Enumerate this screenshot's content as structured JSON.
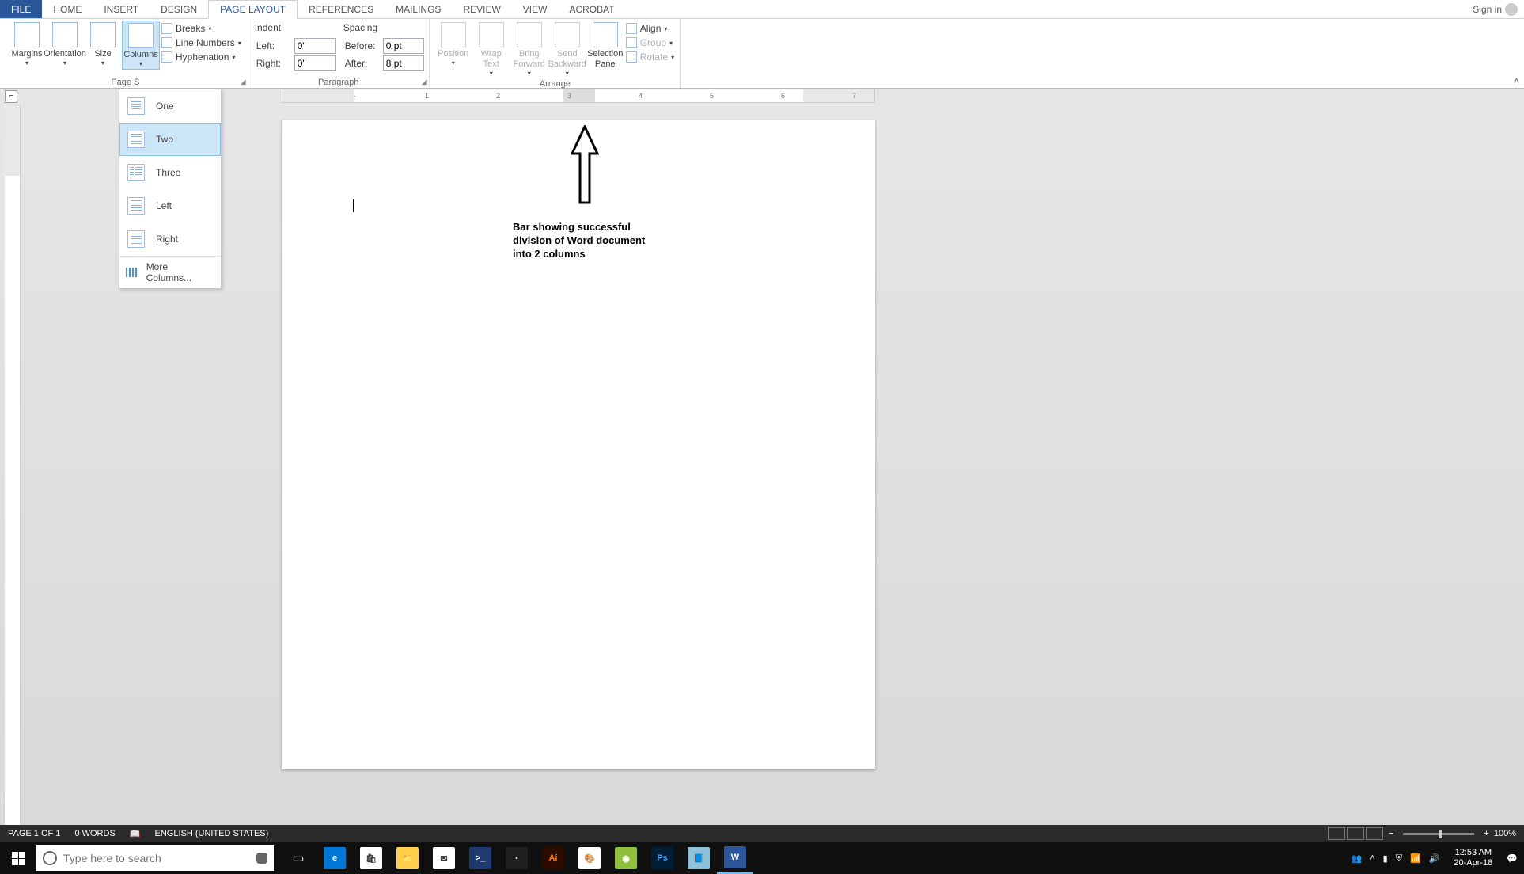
{
  "tabs": {
    "file": "FILE",
    "home": "HOME",
    "insert": "INSERT",
    "design": "DESIGN",
    "pagelayout": "PAGE LAYOUT",
    "references": "REFERENCES",
    "mailings": "MAILINGS",
    "review": "REVIEW",
    "view": "VIEW",
    "acrobat": "ACROBAT"
  },
  "signin": "Sign in",
  "ribbon": {
    "page_setup": {
      "label": "Page Setup",
      "label_truncated": "Page S",
      "margins": "Margins",
      "orientation": "Orientation",
      "size": "Size",
      "columns": "Columns",
      "breaks": "Breaks",
      "line_numbers": "Line Numbers",
      "hyphenation": "Hyphenation"
    },
    "paragraph": {
      "label": "Paragraph",
      "indent": "Indent",
      "spacing": "Spacing",
      "left": "Left:",
      "right": "Right:",
      "before": "Before:",
      "after": "After:",
      "left_val": "0\"",
      "right_val": "0\"",
      "before_val": "0 pt",
      "after_val": "8 pt"
    },
    "arrange": {
      "label": "Arrange",
      "position": "Position",
      "wrap": "Wrap\nText",
      "forward": "Bring\nForward",
      "backward": "Send\nBackward",
      "pane": "Selection\nPane",
      "align": "Align",
      "group": "Group",
      "rotate": "Rotate"
    }
  },
  "columns_menu": {
    "one": "One",
    "two": "Two",
    "three": "Three",
    "left": "Left",
    "right": "Right",
    "more": "More Columns..."
  },
  "ruler_numbers": [
    "1",
    "2",
    "3",
    "4",
    "5",
    "6",
    "7"
  ],
  "document": {
    "note": "Bar showing successful division of Word document into 2 columns"
  },
  "status": {
    "page": "PAGE 1 OF 1",
    "words": "0 WORDS",
    "lang": "ENGLISH (UNITED STATES)",
    "zoom": "100%",
    "minus": "−",
    "plus": "+"
  },
  "taskbar": {
    "search_placeholder": "Type here to search",
    "time": "12:53 AM",
    "date": "20-Apr-18"
  }
}
